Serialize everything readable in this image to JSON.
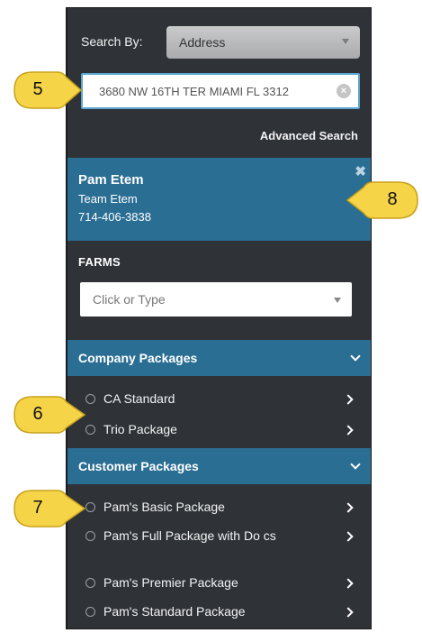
{
  "search": {
    "label": "Search By:",
    "type_value": "Address",
    "address_value": "3680 NW 16TH TER MIAMI FL 3312",
    "advanced_label": "Advanced Search"
  },
  "user": {
    "name": "Pam Etem",
    "team": "Team Etem",
    "phone": "714-406-3838"
  },
  "farms": {
    "label": "FARMS",
    "placeholder": "Click or Type"
  },
  "company_packages": {
    "title": "Company Packages",
    "items": [
      {
        "label": "CA Standard"
      },
      {
        "label": "Trio Package"
      }
    ]
  },
  "customer_packages": {
    "title": "Customer Packages",
    "items": [
      {
        "label": "Pam's Basic Package"
      },
      {
        "label": "Pam's Full Package with Do cs"
      },
      {
        "label": "Pam's Premier Package"
      },
      {
        "label": "Pam's Standard Package"
      }
    ]
  },
  "callouts": {
    "c5": "5",
    "c6": "6",
    "c7": "7",
    "c8": "8"
  },
  "colors": {
    "panel_bg": "#2f3337",
    "accent": "#2a6e94",
    "callout_fill": "#f5d547"
  }
}
